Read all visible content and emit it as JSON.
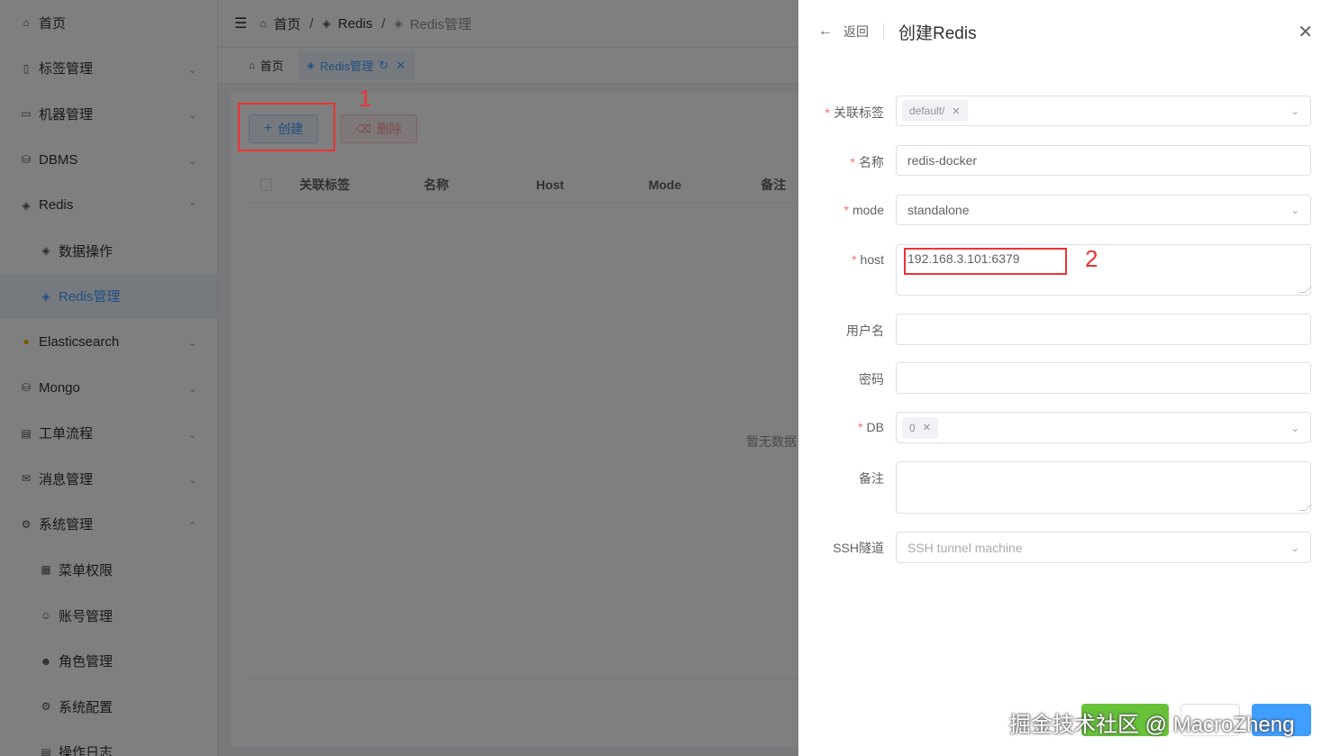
{
  "sidebar": {
    "items": [
      {
        "label": "首页",
        "icon": "home-icon"
      },
      {
        "label": "标签管理",
        "icon": "bookmark-icon",
        "chevron": "down"
      },
      {
        "label": "机器管理",
        "icon": "monitor-icon",
        "chevron": "down"
      },
      {
        "label": "DBMS",
        "icon": "database-icon",
        "chevron": "down"
      },
      {
        "label": "Redis",
        "icon": "stack-icon",
        "chevron": "up"
      },
      {
        "label": "数据操作",
        "icon": "stack-icon",
        "sub": true
      },
      {
        "label": "Redis管理",
        "icon": "stack-icon",
        "sub": true,
        "active": true
      },
      {
        "label": "Elasticsearch",
        "icon": "elasticsearch-icon",
        "chevron": "down"
      },
      {
        "label": "Mongo",
        "icon": "database-icon",
        "chevron": "down"
      },
      {
        "label": "工单流程",
        "icon": "document-icon",
        "chevron": "down"
      },
      {
        "label": "消息管理",
        "icon": "mail-icon",
        "chevron": "down"
      },
      {
        "label": "系统管理",
        "icon": "gear-icon",
        "chevron": "up"
      },
      {
        "label": "菜单权限",
        "icon": "grid-icon",
        "sub": true
      },
      {
        "label": "账号管理",
        "icon": "user-icon",
        "sub": true
      },
      {
        "label": "角色管理",
        "icon": "users-icon",
        "sub": true
      },
      {
        "label": "系统配置",
        "icon": "gear-icon",
        "sub": true
      },
      {
        "label": "操作日志",
        "icon": "log-icon",
        "sub": true
      }
    ]
  },
  "header": {
    "breadcrumb": [
      "首页",
      "Redis",
      "Redis管理"
    ]
  },
  "tags": {
    "home": "首页",
    "current": "Redis管理"
  },
  "main": {
    "create_label": "创建",
    "delete_label": "删除",
    "columns": [
      "关联标签",
      "名称",
      "Host",
      "Mode",
      "备注"
    ],
    "empty_text": "暂无数据"
  },
  "annotations": {
    "one": "1",
    "two": "2"
  },
  "drawer": {
    "back_label": "返回",
    "title": "创建Redis",
    "fields": {
      "tag": {
        "label": "关联标签",
        "chip": "default/"
      },
      "name": {
        "label": "名称",
        "value": "redis-docker"
      },
      "mode": {
        "label": "mode",
        "value": "standalone"
      },
      "host": {
        "label": "host",
        "value": "192.168.3.101:6379"
      },
      "username": {
        "label": "用户名",
        "value": ""
      },
      "password": {
        "label": "密码",
        "value": ""
      },
      "db": {
        "label": "DB",
        "chip": "0"
      },
      "remark": {
        "label": "备注",
        "value": ""
      },
      "ssh": {
        "label": "SSH隧道",
        "placeholder": "SSH tunnel machine"
      }
    },
    "required_mark": "*"
  },
  "watermark": "掘金技术社区 @ MacroZheng",
  "colors": {
    "primary": "#409eff",
    "danger": "#f56c6c",
    "annotation": "#ee3333",
    "success": "#67c23a"
  }
}
